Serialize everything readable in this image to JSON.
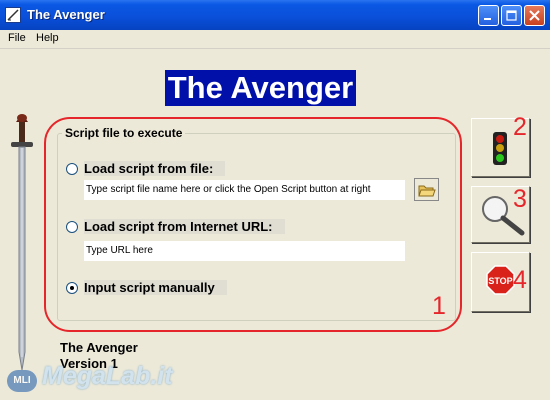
{
  "window": {
    "title": "The Avenger"
  },
  "menu": {
    "items": [
      "File",
      "Help"
    ]
  },
  "banner": {
    "text": "The Avenger"
  },
  "script_group": {
    "title": "Script file to execute",
    "options": [
      {
        "label": "Load script from file:",
        "selected": false,
        "field_value": "Type script file name here or click the Open Script button at right"
      },
      {
        "label": "Load script from Internet URL:",
        "selected": false,
        "field_value": "Type URL here"
      },
      {
        "label": "Input script manually",
        "selected": true
      }
    ]
  },
  "side_buttons": [
    {
      "icon": "traffic-light-icon"
    },
    {
      "icon": "magnifier-icon"
    },
    {
      "icon": "stop-sign-icon",
      "label": "STOP"
    }
  ],
  "annotations": [
    "1",
    "2",
    "3",
    "4"
  ],
  "annotation_color": "#e5262b",
  "info": {
    "name": "The Avenger",
    "version": "Version 1"
  },
  "watermark": {
    "logo": "MLI",
    "text": "MegaLab.it"
  }
}
